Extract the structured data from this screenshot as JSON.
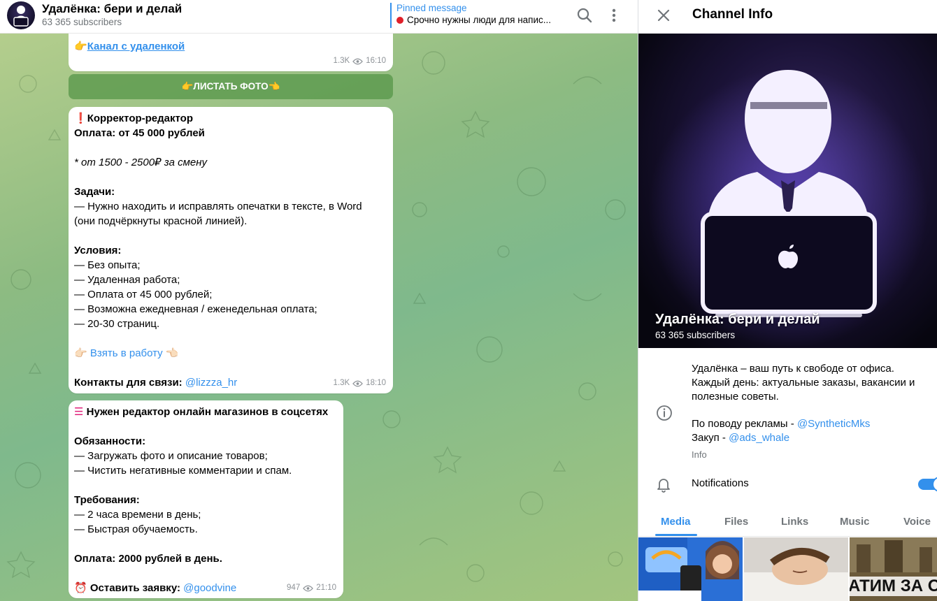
{
  "chat_header": {
    "title": "Удалёнка: бери и делай",
    "subscribers": "63 365 subscribers",
    "pinned_title": "Pinned message",
    "pinned_text": "Срочно нужны люди для напис...",
    "search_icon": "search-icon",
    "more_icon": "more-vertical-icon"
  },
  "messages": [
    {
      "link_text": "Канал с удаленкой",
      "emoji": "👉",
      "views": "1.3K",
      "time": "16:10"
    },
    {
      "title": "Корректор-редактор",
      "salary": "Оплата: от 45 000 рублей",
      "note": "* от 1500 - 2500₽ за смену",
      "tasks_head": "Задачи:",
      "tasks": [
        "— Нужно находить и исправлять опечатки в тексте, в Word",
        "(они подчёркнуты красной линией)."
      ],
      "cond_head": "Условия:",
      "conditions": [
        "— Без опыта;",
        "— Удаленная работа;",
        "— Оплата от 45 000 рублей;",
        "— Возможна ежедневная / еженедельная оплата;",
        "— 20-30 страниц."
      ],
      "cta": "Взять в работу",
      "contacts_label": "Контакты для связи:",
      "contact": "@lizzza_hr",
      "views": "1.3K",
      "time": "18:10"
    },
    {
      "title": "Нужен редактор онлайн магазинов в соцсетях",
      "duties_head": "Обязанности:",
      "duties": [
        "— Загружать фото и описание товаров;",
        "— Чистить негативные комментарии и спам."
      ],
      "req_head": "Требования:",
      "requirements": [
        "— 2 часа времени в день;",
        "— Быстрая обучаемость."
      ],
      "pay": "Оплата: 2000 рублей в день.",
      "apply_label": "Оставить заявку:",
      "apply_contact": "@goodvine",
      "views": "947",
      "time": "21:10"
    }
  ],
  "inline_button": "👉ЛИСТАТЬ ФОТО👈",
  "info_panel": {
    "title": "Channel Info",
    "channel_name": "Удалёнка: бери и делай",
    "subscribers": "63 365 subscribers",
    "about_lines": [
      "Удалёнка – ваш путь к свободе от офиса.",
      "Каждый день: актуальные заказы, вакансии и",
      "полезные советы."
    ],
    "ads_label": "По поводу рекламы - ",
    "ads_contact": "@SyntheticMks",
    "buy_label": "Закуп - ",
    "buy_contact": "@ads_whale",
    "about_caption": "Info",
    "notifications_label": "Notifications",
    "notifications_on": true,
    "tabs": [
      "Media",
      "Files",
      "Links",
      "Music",
      "Voice"
    ],
    "active_tab": "Media",
    "thumb3_text": "АТИМ ЗА ОТЗ"
  },
  "colors": {
    "accent": "#3390ec",
    "muted": "#707579",
    "bubble": "#ffffff"
  }
}
